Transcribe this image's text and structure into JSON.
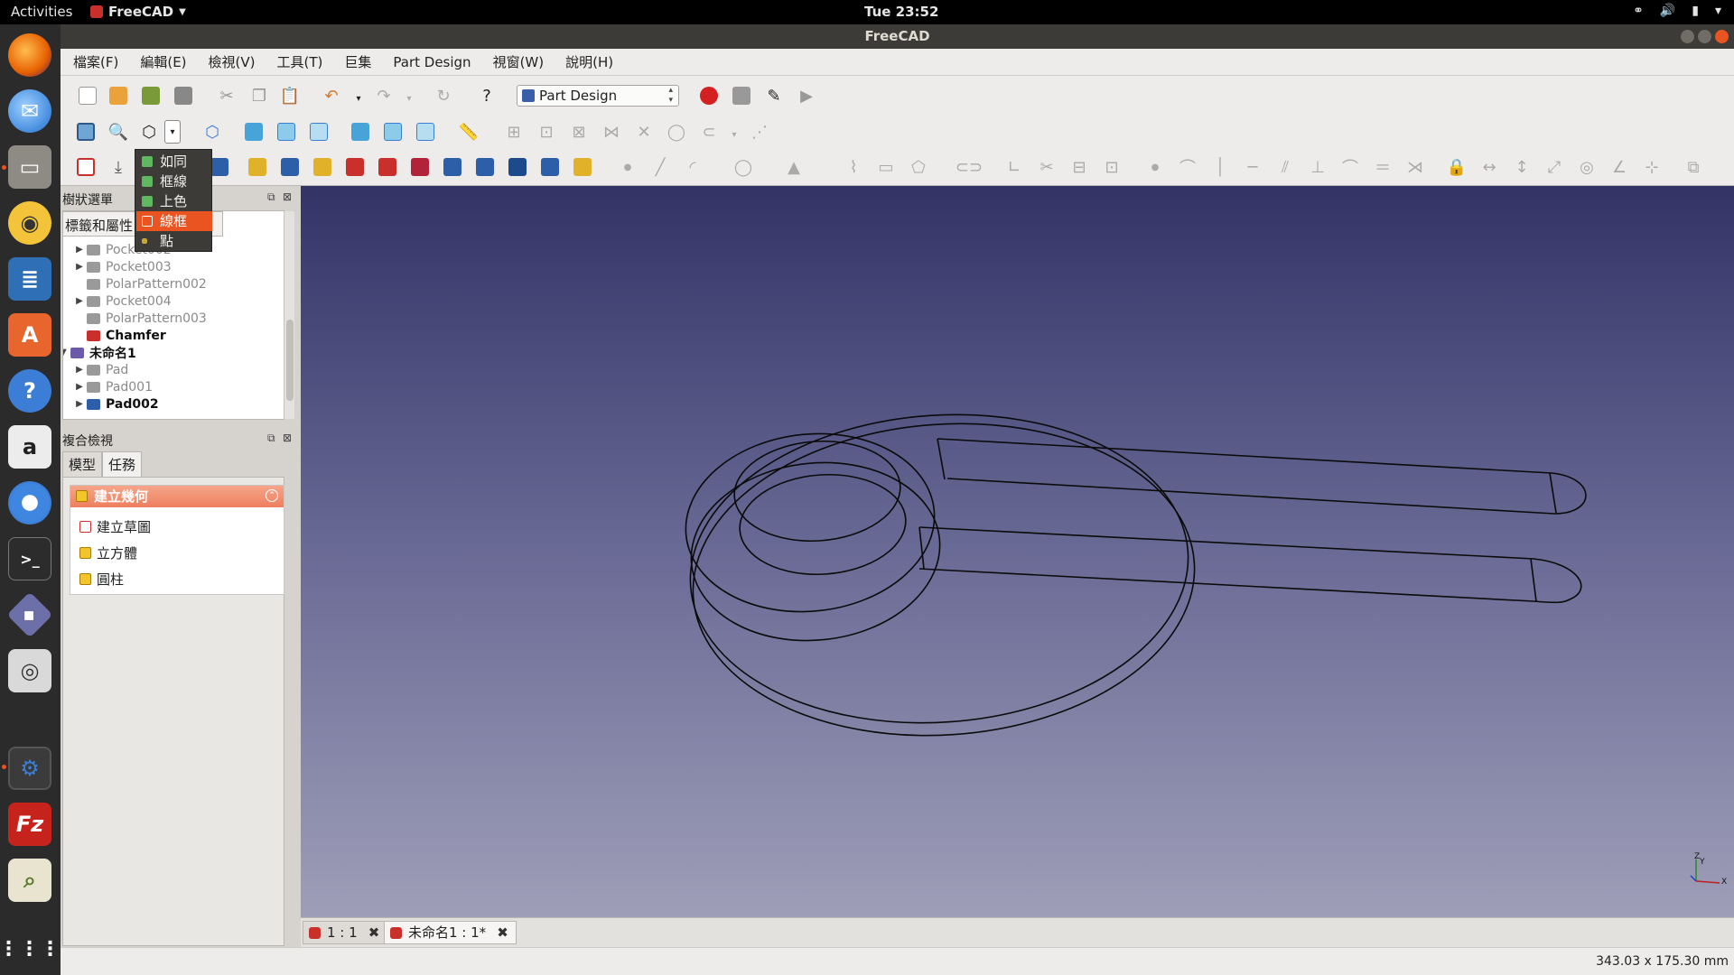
{
  "system": {
    "activities": "Activities",
    "app_name": "FreeCAD",
    "clock": "Tue 23:52"
  },
  "window": {
    "title": "FreeCAD"
  },
  "menu": [
    "檔案(F)",
    "編輯(E)",
    "檢視(V)",
    "工具(T)",
    "巨集",
    "Part Design",
    "視窗(W)",
    "說明(H)"
  ],
  "toolbar": {
    "workbench": "Part Design"
  },
  "draw_style_menu": {
    "items": [
      {
        "label": "如同",
        "selected": false
      },
      {
        "label": "框線",
        "selected": false
      },
      {
        "label": "上色",
        "selected": false
      },
      {
        "label": "線框",
        "selected": true
      },
      {
        "label": "點",
        "selected": false
      }
    ]
  },
  "tree_panel": {
    "title": "樹狀選單",
    "tab_label": "標籤和屬性",
    "rows": [
      {
        "label": "Pocket002",
        "style": "dim",
        "expand": "▶",
        "indent": 1
      },
      {
        "label": "Pocket003",
        "style": "dim",
        "expand": "▶",
        "indent": 1
      },
      {
        "label": "PolarPattern002",
        "style": "dim",
        "expand": "",
        "indent": 1
      },
      {
        "label": "Pocket004",
        "style": "dim",
        "expand": "▶",
        "indent": 1
      },
      {
        "label": "PolarPattern003",
        "style": "dim",
        "expand": "",
        "indent": 1
      },
      {
        "label": "Chamfer",
        "style": "bold",
        "expand": "",
        "indent": 1
      },
      {
        "label": "未命名1",
        "style": "bold",
        "expand": "▼",
        "indent": 0
      },
      {
        "label": "Pad",
        "style": "dim",
        "expand": "▶",
        "indent": 1
      },
      {
        "label": "Pad001",
        "style": "dim",
        "expand": "▶",
        "indent": 1
      },
      {
        "label": "Pad002",
        "style": "bold",
        "expand": "▶",
        "indent": 1
      }
    ]
  },
  "combo_view": {
    "title": "複合檢視",
    "tabs": [
      "模型",
      "任務"
    ],
    "selected_tab": "任務",
    "task": {
      "header": "建立幾何",
      "items": [
        "建立草圖",
        "立方體",
        "圓柱"
      ]
    }
  },
  "doc_tabs": [
    {
      "label": "1 : 1",
      "selected": false
    },
    {
      "label": "未命名1 : 1*",
      "selected": true
    }
  ],
  "status": {
    "dimensions": "343.03 x 175.30 mm"
  },
  "axis_labels": {
    "x": "X",
    "y": "Y",
    "z": "Z"
  }
}
